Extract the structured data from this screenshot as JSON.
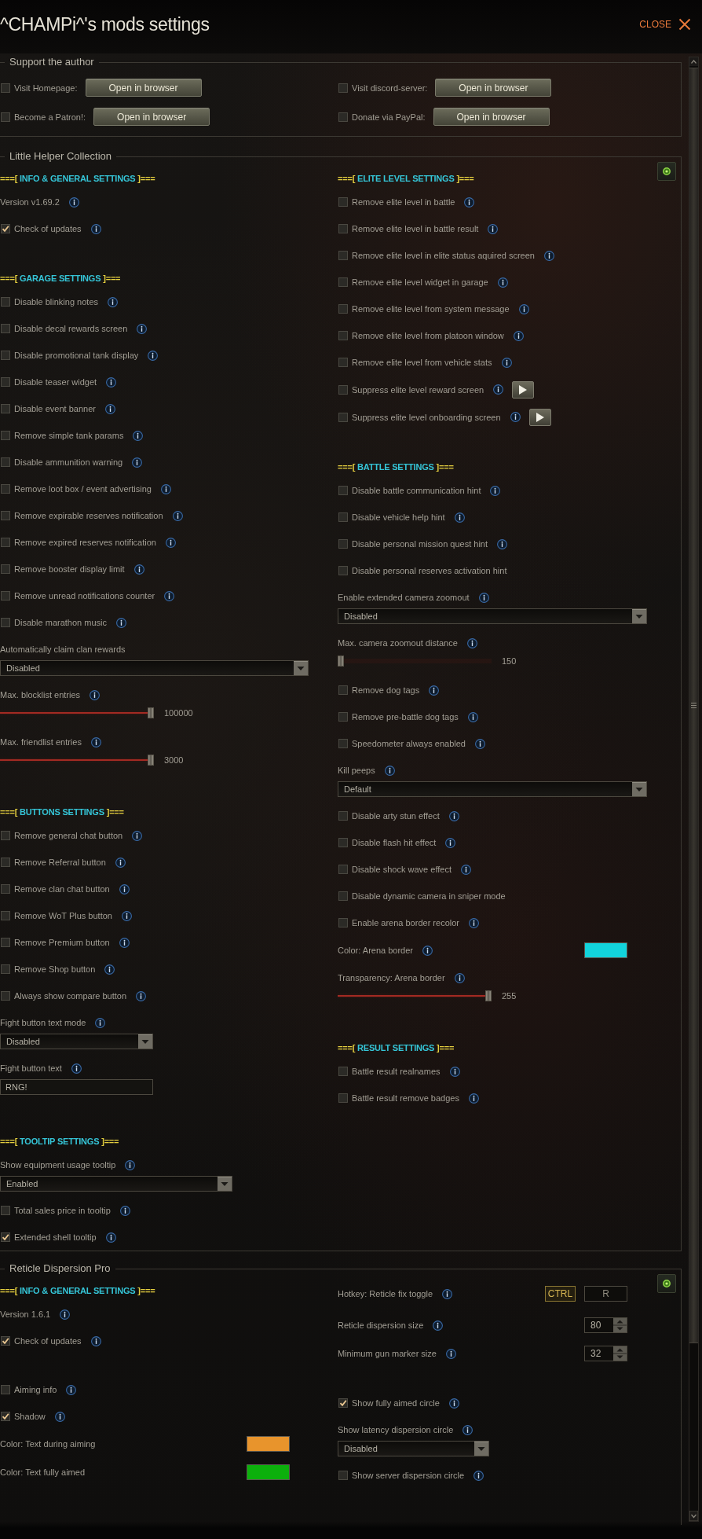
{
  "window": {
    "title": "^CHAMPi^'s mods settings",
    "close_label": "CLOSE"
  },
  "panels": [
    {
      "kind": "links",
      "title": "Support the author",
      "items": [
        {
          "label": "Visit Homepage:",
          "checked": false,
          "button": "Open in browser"
        },
        {
          "label": "Visit discord-server:",
          "checked": false,
          "button": "Open in browser"
        },
        {
          "label": "Become a Patron!:",
          "checked": false,
          "button": "Open in browser"
        },
        {
          "label": "Donate via PayPal:",
          "checked": false,
          "button": "Open in browser"
        }
      ]
    },
    {
      "kind": "settings",
      "title": "Little Helper Collection",
      "columns": [
        {
          "groups": [
            {
              "heading": {
                "prefix": "===[",
                "text": "INFO & GENERAL SETTINGS",
                "suffix": "]==="
              },
              "items": [
                {
                  "kind": "text",
                  "label": "Version v1.69.2",
                  "info": true
                },
                {
                  "kind": "checkbox",
                  "label": "Check of updates",
                  "checked": true,
                  "info": true
                }
              ]
            },
            {
              "heading": {
                "prefix": "===[",
                "text": "GARAGE SETTINGS",
                "suffix": "]==="
              },
              "items": [
                {
                  "kind": "checkbox",
                  "label": "Disable blinking notes",
                  "checked": false,
                  "info": true
                },
                {
                  "kind": "checkbox",
                  "label": "Disable decal rewards screen",
                  "checked": false,
                  "info": true
                },
                {
                  "kind": "checkbox",
                  "label": "Disable promotional tank display",
                  "checked": false,
                  "info": true
                },
                {
                  "kind": "checkbox",
                  "label": "Disable teaser widget",
                  "checked": false,
                  "info": true
                },
                {
                  "kind": "checkbox",
                  "label": "Disable event banner",
                  "checked": false,
                  "info": true
                },
                {
                  "kind": "checkbox",
                  "label": "Remove simple tank params",
                  "checked": false,
                  "info": true
                },
                {
                  "kind": "checkbox",
                  "label": "Disable ammunition warning",
                  "checked": false,
                  "info": true
                },
                {
                  "kind": "checkbox",
                  "label": "Remove loot box / event advertising",
                  "checked": false,
                  "info": true
                },
                {
                  "kind": "checkbox",
                  "label": "Remove expirable reserves notification",
                  "checked": false,
                  "info": true
                },
                {
                  "kind": "checkbox",
                  "label": "Remove expired reserves notification",
                  "checked": false,
                  "info": true
                },
                {
                  "kind": "checkbox",
                  "label": "Remove booster display limit",
                  "checked": false,
                  "info": true
                },
                {
                  "kind": "checkbox",
                  "label": "Remove unread notifications counter",
                  "checked": false,
                  "info": true
                },
                {
                  "kind": "checkbox",
                  "label": "Disable marathon music",
                  "checked": false,
                  "info": true
                },
                {
                  "kind": "dropdown",
                  "label": "Automatically claim clan rewards",
                  "info": false,
                  "value": "Disabled"
                },
                {
                  "kind": "slider",
                  "label": "Max. blocklist entries",
                  "info": true,
                  "level": 1,
                  "reading": "100000"
                },
                {
                  "kind": "slider",
                  "label": "Max. friendlist entries",
                  "info": true,
                  "level": 1,
                  "reading": "3000"
                }
              ]
            },
            {
              "heading": {
                "prefix": "===[",
                "text": "BUTTONS SETTINGS",
                "suffix": "]==="
              },
              "items": [
                {
                  "kind": "checkbox",
                  "label": "Remove general chat button",
                  "checked": false,
                  "info": true
                },
                {
                  "kind": "checkbox",
                  "label": "Remove Referral button",
                  "checked": false,
                  "info": true
                },
                {
                  "kind": "checkbox",
                  "label": "Remove clan chat button",
                  "checked": false,
                  "info": true
                },
                {
                  "kind": "checkbox",
                  "label": "Remove WoT Plus button",
                  "checked": false,
                  "info": true
                },
                {
                  "kind": "checkbox",
                  "label": "Remove Premium button",
                  "checked": false,
                  "info": true
                },
                {
                  "kind": "checkbox",
                  "label": "Remove Shop button",
                  "checked": false,
                  "info": true
                },
                {
                  "kind": "checkbox",
                  "label": "Always show compare button",
                  "checked": false,
                  "info": true
                },
                {
                  "kind": "dropdown",
                  "label": "Fight button text mode",
                  "info": true,
                  "value": "Disabled"
                },
                {
                  "kind": "input",
                  "label": "Fight button text",
                  "info": true,
                  "value": "RNG!"
                }
              ]
            },
            {
              "heading": {
                "prefix": "===[",
                "text": "TOOLTIP SETTINGS",
                "suffix": "]==="
              },
              "items": [
                {
                  "kind": "dropdown",
                  "label": "Show equipment usage tooltip",
                  "info": true,
                  "value": "Enabled"
                },
                {
                  "kind": "checkbox",
                  "label": "Total sales price in tooltip",
                  "checked": false,
                  "info": true
                },
                {
                  "kind": "checkbox",
                  "label": "Extended shell tooltip",
                  "checked": true,
                  "info": true
                }
              ]
            }
          ]
        },
        {
          "groups": [
            {
              "heading": {
                "prefix": "===[",
                "text": "ELITE LEVEL SETTINGS",
                "suffix": "]==="
              },
              "items": [
                {
                  "kind": "checkbox",
                  "label": "Remove elite level in battle",
                  "checked": false,
                  "info": true
                },
                {
                  "kind": "checkbox",
                  "label": "Remove elite level in battle result",
                  "checked": false,
                  "info": true
                },
                {
                  "kind": "checkbox",
                  "label": "Remove elite level in elite status aquired screen",
                  "checked": false,
                  "info": true
                },
                {
                  "kind": "checkbox",
                  "label": "Remove elite level widget in garage",
                  "checked": false,
                  "info": true
                },
                {
                  "kind": "checkbox",
                  "label": "Remove elite level from system message",
                  "checked": false,
                  "info": true
                },
                {
                  "kind": "checkbox",
                  "label": "Remove elite level from platoon window",
                  "checked": false,
                  "info": true
                },
                {
                  "kind": "checkbox",
                  "label": "Remove elite level from vehicle stats",
                  "checked": false,
                  "info": true
                },
                {
                  "kind": "preview",
                  "label": "Suppress elite level reward screen",
                  "checked": false,
                  "info": true
                },
                {
                  "kind": "preview",
                  "label": "Suppress elite level onboarding screen",
                  "checked": false,
                  "info": true
                }
              ]
            },
            {
              "heading": {
                "prefix": "===[",
                "text": "BATTLE SETTINGS",
                "suffix": "]==="
              },
              "items": [
                {
                  "kind": "checkbox",
                  "label": "Disable battle communication hint",
                  "checked": false,
                  "info": true
                },
                {
                  "kind": "checkbox",
                  "label": "Disable vehicle help hint",
                  "checked": false,
                  "info": true
                },
                {
                  "kind": "checkbox",
                  "label": "Disable personal mission quest hint",
                  "checked": false,
                  "info": true
                },
                {
                  "kind": "checkbox",
                  "label": "Disable personal reserves activation hint",
                  "checked": false,
                  "info": false
                },
                {
                  "kind": "dropdown",
                  "label": "Enable extended camera zoomout",
                  "info": true,
                  "value": "Disabled"
                },
                {
                  "kind": "slider",
                  "label": "Max. camera zoomout distance",
                  "info": true,
                  "level": 0,
                  "reading": "150"
                },
                {
                  "kind": "checkbox",
                  "label": "Remove dog tags",
                  "checked": false,
                  "info": true
                },
                {
                  "kind": "checkbox",
                  "label": "Remove pre-battle dog tags",
                  "checked": false,
                  "info": true
                },
                {
                  "kind": "checkbox",
                  "label": "Speedometer always enabled",
                  "checked": false,
                  "info": true
                },
                {
                  "kind": "dropdown",
                  "label": "Kill peeps",
                  "info": true,
                  "value": "Default"
                },
                {
                  "kind": "checkbox",
                  "label": "Disable arty stun effect",
                  "checked": false,
                  "info": true
                },
                {
                  "kind": "checkbox",
                  "label": "Disable flash hit effect",
                  "checked": false,
                  "info": true
                },
                {
                  "kind": "checkbox",
                  "label": "Disable shock wave effect",
                  "checked": false,
                  "info": true
                },
                {
                  "kind": "checkbox",
                  "label": "Disable dynamic camera in sniper mode",
                  "checked": false,
                  "info": false
                },
                {
                  "kind": "checkbox",
                  "label": "Enable arena border recolor",
                  "checked": false,
                  "info": true
                },
                {
                  "kind": "color",
                  "label": "Color: Arena border",
                  "info": true,
                  "color": "#12d4dc"
                },
                {
                  "kind": "slider",
                  "label": "Transparency: Arena border",
                  "info": true,
                  "level": 1,
                  "reading": "255"
                }
              ]
            },
            {
              "heading": {
                "prefix": "===[",
                "text": "RESULT SETTINGS",
                "suffix": "]==="
              },
              "items": [
                {
                  "kind": "checkbox",
                  "label": "Battle result realnames",
                  "checked": false,
                  "info": true
                },
                {
                  "kind": "checkbox",
                  "label": "Battle result remove badges",
                  "checked": false,
                  "info": true
                }
              ]
            }
          ]
        }
      ]
    },
    {
      "kind": "settings",
      "title": "Reticle Dispersion Pro",
      "columns": [
        {
          "groups": [
            {
              "heading": {
                "prefix": "===[",
                "text": "INFO & GENERAL SETTINGS",
                "suffix": "]==="
              },
              "items": [
                {
                  "kind": "text",
                  "label": "Version 1.6.1",
                  "info": true
                },
                {
                  "kind": "checkbox",
                  "label": "Check of updates",
                  "checked": true,
                  "info": true
                }
              ]
            },
            {
              "items": [
                {
                  "kind": "checkbox",
                  "label": "Aiming info",
                  "checked": false,
                  "info": true
                },
                {
                  "kind": "checkbox",
                  "label": "Shadow",
                  "checked": true,
                  "info": true
                },
                {
                  "kind": "color",
                  "label": "Color: Text during aiming",
                  "info": false,
                  "color": "#e8942c"
                },
                {
                  "kind": "color",
                  "label": "Color: Text fully aimed",
                  "info": false,
                  "color": "#0cb00c"
                }
              ]
            }
          ]
        },
        {
          "groups": [
            {
              "items": [
                {
                  "kind": "hotkey",
                  "label": "Hotkey: Reticle fix toggle",
                  "info": true,
                  "keys": [
                    {
                      "kind": "modifier",
                      "label": "CTRL"
                    },
                    {
                      "kind": "key",
                      "label": "R"
                    }
                  ]
                },
                {
                  "kind": "spinner",
                  "label": "Reticle dispersion size",
                  "info": true,
                  "value": "80"
                },
                {
                  "kind": "spinner",
                  "label": "Minimum gun marker size",
                  "info": true,
                  "value": "32"
                }
              ]
            },
            {
              "items": [
                {
                  "kind": "checkbox",
                  "label": "Show fully aimed circle",
                  "checked": true,
                  "info": true
                },
                {
                  "kind": "dropdown",
                  "label": "Show latency dispersion circle",
                  "info": true,
                  "value": "Disabled"
                },
                {
                  "kind": "checkbox",
                  "label": "Show server dispersion circle",
                  "checked": false,
                  "info": true
                }
              ]
            }
          ]
        }
      ]
    }
  ]
}
